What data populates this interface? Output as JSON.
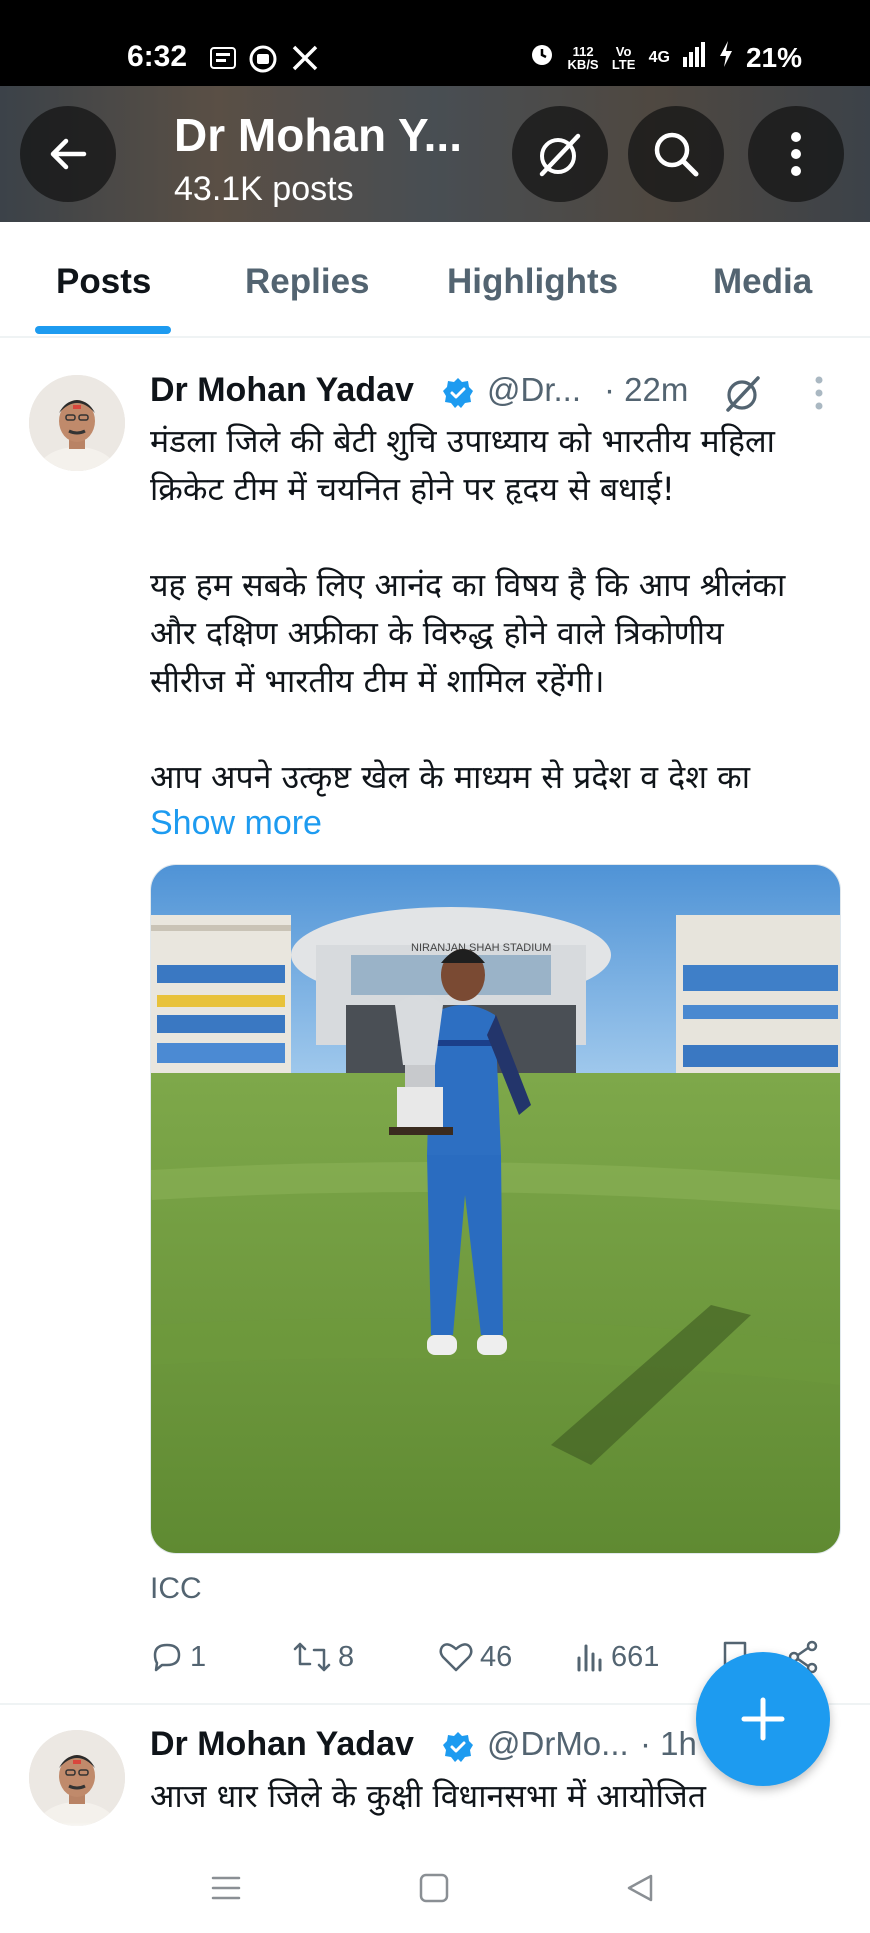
{
  "status_bar": {
    "time": "6:32",
    "left_icons": [
      "dainik-bhaskar-icon",
      "youtube-icon",
      "x-icon"
    ],
    "speed_value": "112",
    "speed_unit": "KB/S",
    "network": "Vo LTE",
    "signal": "4G",
    "battery": "21%"
  },
  "header": {
    "title": "Dr Mohan Y...",
    "subtitle": "43.1K posts"
  },
  "tabs": [
    {
      "label": "Posts",
      "active": true
    },
    {
      "label": "Replies",
      "active": false
    },
    {
      "label": "Highlights",
      "active": false
    },
    {
      "label": "Media",
      "active": false
    }
  ],
  "posts": [
    {
      "name": "Dr Mohan Yadav",
      "handle": "@Dr...",
      "time": "· 22m",
      "text_lines": [
        "मंडला जिले की बेटी शुचि उपाध्याय को भारतीय महिला",
        "क्रिकेट टीम में चयनित होने पर हृदय से बधाई!",
        "",
        "यह हम सबके लिए आनंद का विषय है कि आप श्रीलंका",
        "और दक्षिण अफ्रीका के विरुद्ध होने वाले त्रिकोणीय",
        "सीरीज में भारतीय टीम में शामिल रहेंगी।",
        "",
        "आप अपने उत्कृष्ट खेल के माध्यम से प्रदेश व देश का"
      ],
      "show_more": "Show more",
      "media_sign": "NIRANJAN SHAH STADIUM",
      "media_credit": "ICC",
      "replies": "1",
      "reposts": "8",
      "likes": "46",
      "views": "661"
    },
    {
      "name": "Dr Mohan Yadav",
      "handle": "@DrMo...",
      "time": "· 1h",
      "text_lines": [
        "आज धार जिले के कुक्षी विधानसभा में आयोजित"
      ]
    }
  ],
  "colors": {
    "accent": "#1d9bf0",
    "text_primary": "#0f1419",
    "text_secondary": "#536471"
  }
}
